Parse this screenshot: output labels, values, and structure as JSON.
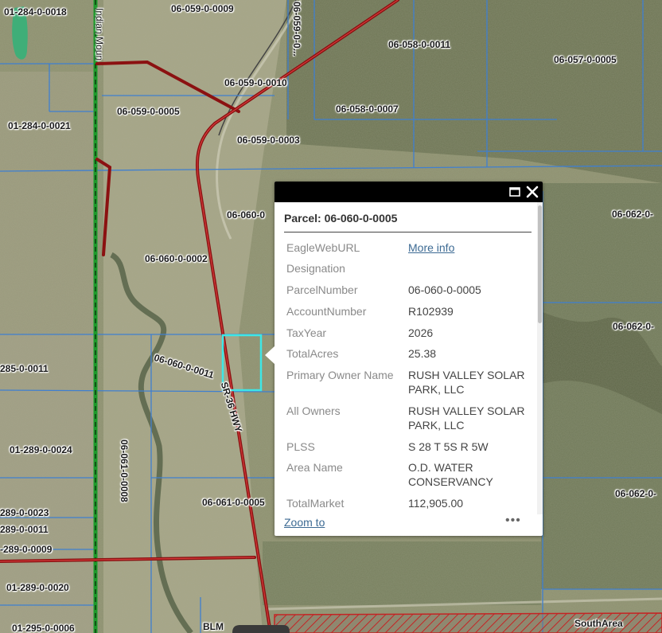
{
  "map": {
    "parcel_labels": [
      {
        "id": "01-284-0-0018"
      },
      {
        "id": "06-059-0-0009"
      },
      {
        "id": "06-059-0-0..."
      },
      {
        "id": "06-058-0-0011"
      },
      {
        "id": "06-057-0-0005"
      },
      {
        "id": "06-059-0-0010"
      },
      {
        "id": "06-058-0-0007"
      },
      {
        "id": "06-059-0-0005"
      },
      {
        "id": "01-284-0-0021"
      },
      {
        "id": "06-059-0-0003"
      },
      {
        "id": "06-060-0"
      },
      {
        "id": "06-062-0-"
      },
      {
        "id": "06-060-0-0002"
      },
      {
        "id": "06-062-0-"
      },
      {
        "id": "06-060-0-0011"
      },
      {
        "id": "285-0-0011"
      },
      {
        "id": "01-289-0-0024"
      },
      {
        "id": "06-061-0-0008"
      },
      {
        "id": "289-0-0023"
      },
      {
        "id": "06-061-0-0005"
      },
      {
        "id": "06-062-0-"
      },
      {
        "id": "289-0-0011"
      },
      {
        "id": "-289-0-0009"
      },
      {
        "id": "01-289-0-0020"
      },
      {
        "id": "01-295-0-0006"
      },
      {
        "id": "BLM"
      },
      {
        "id": "SouthArea"
      }
    ],
    "road_labels": [
      {
        "text": "Indian Moun"
      },
      {
        "text": "SR-36 HWY"
      }
    ],
    "colors": {
      "parcel_boundary": "#3f7fd0",
      "road": "#8b1111",
      "selected_parcel": "#3ee6e6",
      "hatched_area": "#c42424"
    }
  },
  "popup": {
    "title": "Parcel: 06-060-0-0005",
    "attributes": [
      {
        "key": "EagleWebURL",
        "value": "More info",
        "is_link": true
      },
      {
        "key": "Designation",
        "value": ""
      },
      {
        "key": "ParcelNumber",
        "value": "06-060-0-0005"
      },
      {
        "key": "AccountNumber",
        "value": "R102939"
      },
      {
        "key": "TaxYear",
        "value": "2026"
      },
      {
        "key": "TotalAcres",
        "value": "25.38"
      },
      {
        "key": "Primary Owner Name",
        "value": "RUSH VALLEY SOLAR PARK, LLC"
      },
      {
        "key": "All Owners",
        "value": "RUSH VALLEY SOLAR PARK, LLC"
      },
      {
        "key": "PLSS",
        "value": "S 28 T 5S R 5W"
      },
      {
        "key": "Area Name",
        "value": "O.D. WATER CONSERVANCY"
      },
      {
        "key": "TotalMarket",
        "value": "112,905.00"
      }
    ],
    "zoom_label": "Zoom to",
    "more_label": "•••",
    "maximize_icon": "maximize-icon",
    "close_icon": "close-icon"
  }
}
